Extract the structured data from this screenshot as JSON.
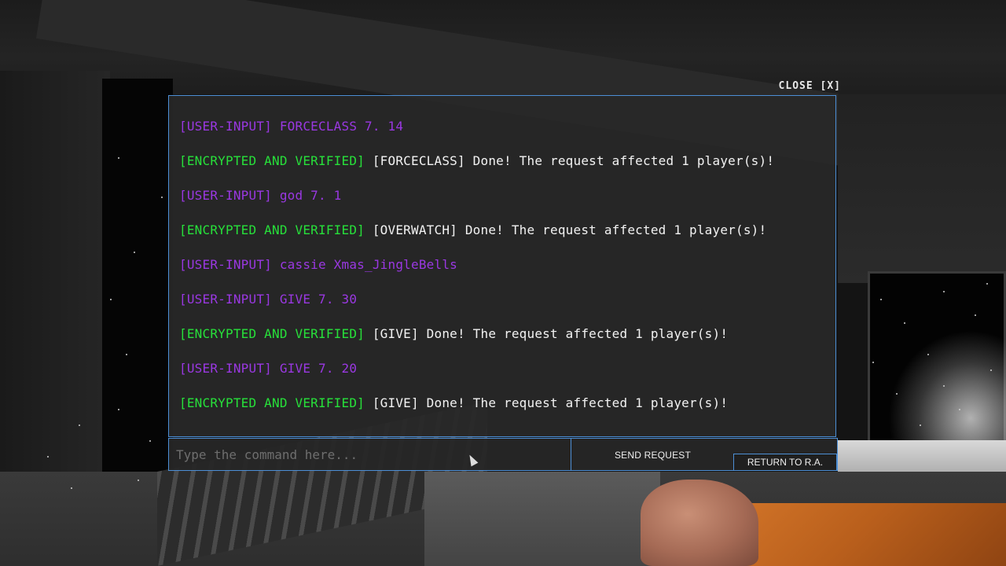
{
  "window": {
    "close_label": "CLOSE [X]"
  },
  "console": {
    "log": [
      {
        "tag": "[USER-INPUT]",
        "tag_type": "user",
        "text": "FORCECLASS 7. 14"
      },
      {
        "tag": "[ENCRYPTED AND VERIFIED]",
        "tag_type": "encrypted",
        "text": "[FORCECLASS] Done! The request affected 1 player(s)!"
      },
      {
        "tag": "[USER-INPUT]",
        "tag_type": "user",
        "text": "god 7. 1"
      },
      {
        "tag": "[ENCRYPTED AND VERIFIED]",
        "tag_type": "encrypted",
        "text": "[OVERWATCH] Done! The request affected 1 player(s)!"
      },
      {
        "tag": "[USER-INPUT]",
        "tag_type": "user",
        "text": "cassie Xmas_JingleBells"
      },
      {
        "tag": "[USER-INPUT]",
        "tag_type": "user",
        "text": "GIVE 7. 30"
      },
      {
        "tag": "[ENCRYPTED AND VERIFIED]",
        "tag_type": "encrypted",
        "text": "[GIVE] Done! The request affected 1 player(s)!"
      },
      {
        "tag": "[USER-INPUT]",
        "tag_type": "user",
        "text": "GIVE 7. 20"
      },
      {
        "tag": "[ENCRYPTED AND VERIFIED]",
        "tag_type": "encrypted",
        "text": "[GIVE] Done! The request affected 1 player(s)!"
      }
    ]
  },
  "command_bar": {
    "input_value": "",
    "input_placeholder": "Type the command here...",
    "send_label": "SEND REQUEST",
    "return_label": "RETURN TO R.A."
  },
  "colors": {
    "user_input": "#9a38e2",
    "encrypted": "#27e03a",
    "message": "#f2f2f2",
    "border": "#4d8fd6"
  }
}
